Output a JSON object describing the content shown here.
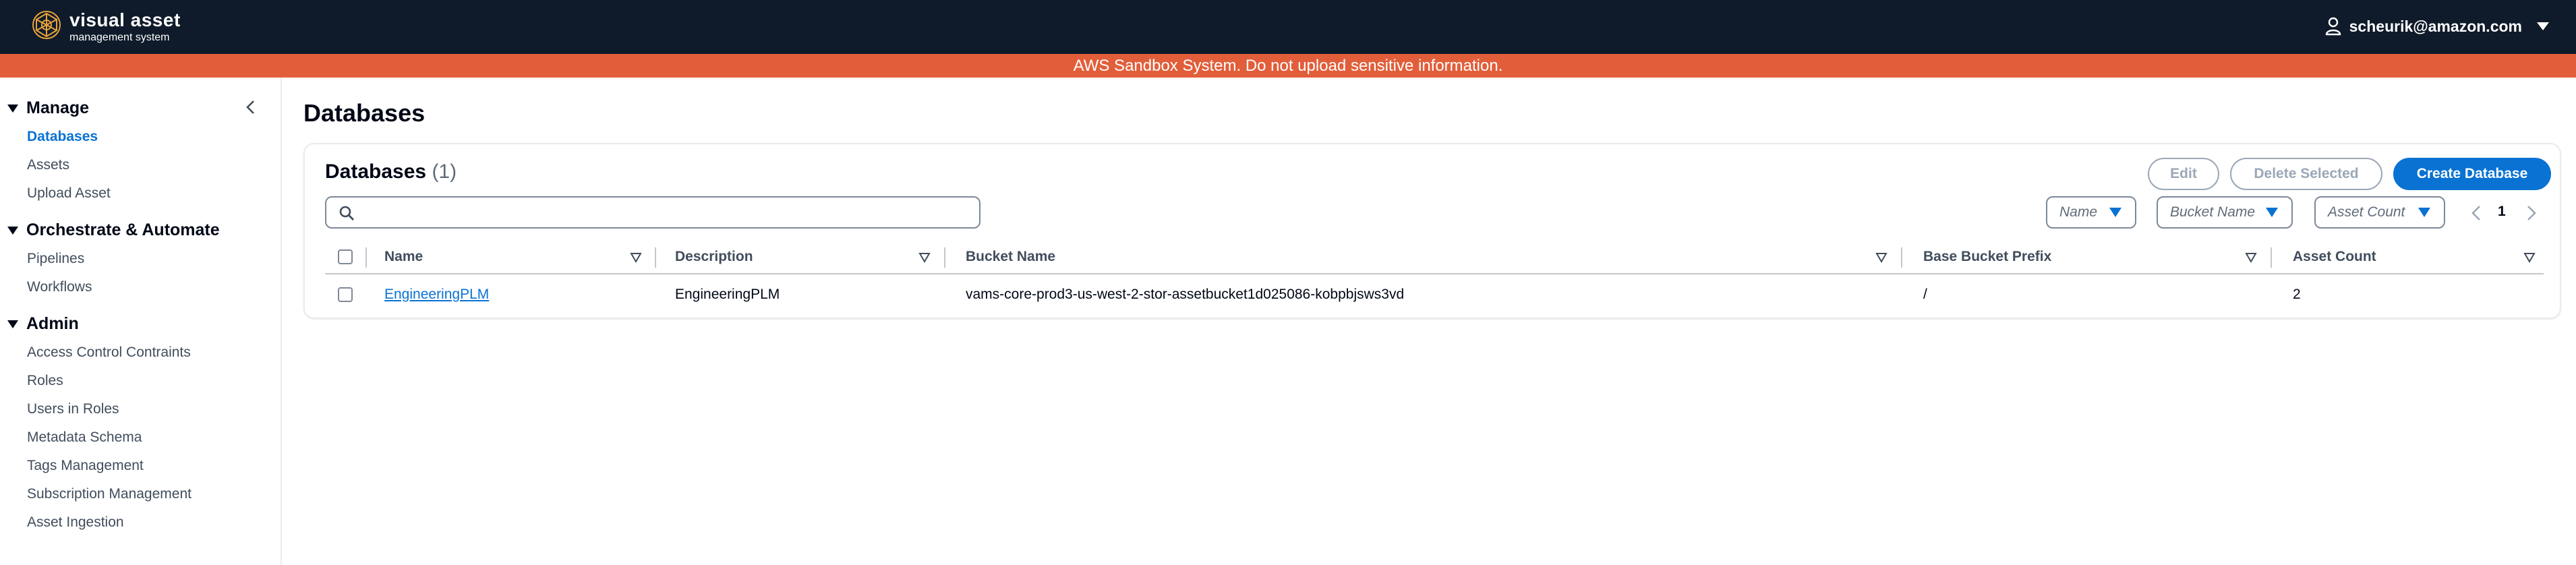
{
  "app": {
    "title_main": "visual asset",
    "title_sub": "management system",
    "user_email": "scheurik@amazon.com"
  },
  "banner": {
    "text": "AWS Sandbox System. Do not upload sensitive information.",
    "color": "#e25e3a"
  },
  "sidebar": {
    "sections": [
      {
        "label": "Manage",
        "items": [
          {
            "label": "Databases",
            "active": true
          },
          {
            "label": "Assets"
          },
          {
            "label": "Upload Asset"
          }
        ]
      },
      {
        "label": "Orchestrate & Automate",
        "items": [
          {
            "label": "Pipelines"
          },
          {
            "label": "Workflows"
          }
        ]
      },
      {
        "label": "Admin",
        "items": [
          {
            "label": "Access Control Contraints"
          },
          {
            "label": "Roles"
          },
          {
            "label": "Users in Roles"
          },
          {
            "label": "Metadata Schema"
          },
          {
            "label": "Tags Management"
          },
          {
            "label": "Subscription Management"
          },
          {
            "label": "Asset Ingestion"
          }
        ]
      }
    ]
  },
  "page": {
    "title": "Databases"
  },
  "card": {
    "title": "Databases",
    "count": "(1)",
    "buttons": {
      "edit": "Edit",
      "delete": "Delete Selected",
      "create": "Create Database"
    },
    "search": {
      "value": "",
      "placeholder": ""
    },
    "sort_selects": [
      "Name",
      "Bucket Name",
      "Asset Count"
    ],
    "pagination": {
      "current_page": "1"
    }
  },
  "table": {
    "columns": [
      "Name",
      "Description",
      "Bucket Name",
      "Base Bucket Prefix",
      "Asset Count"
    ],
    "rows": [
      {
        "name": "EngineeringPLM",
        "description": "EngineeringPLM",
        "bucket_name": "vams-core-prod3-us-west-2-stor-assetbucket1d025086-kobpbjsws3vd",
        "base_bucket_prefix": "/",
        "asset_count": "2"
      }
    ]
  },
  "colors": {
    "topnav": "#0f1b2a",
    "accent": "#0972d3",
    "banner": "#e25e3a"
  },
  "icons": [
    "logo-icon",
    "user-icon",
    "caret-down-icon",
    "collapse-sidebar-icon",
    "search-icon",
    "sort-icon",
    "chevron-left-icon",
    "chevron-right-icon"
  ]
}
